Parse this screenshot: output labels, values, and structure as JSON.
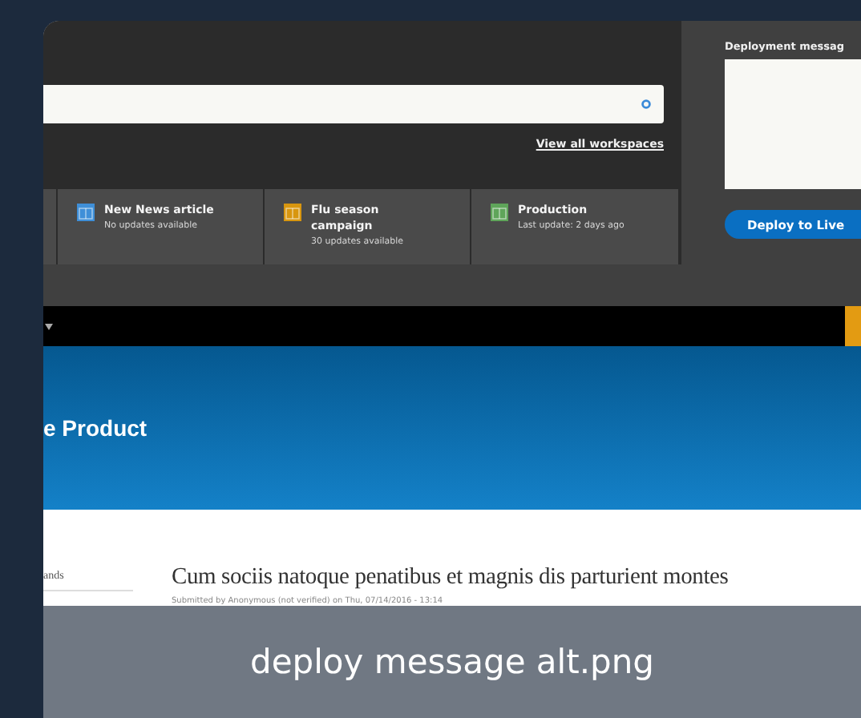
{
  "caption": "deploy message alt.png",
  "workspace_panel": {
    "view_all_link": "View all workspaces",
    "workspaces": [
      {
        "name": "New News article",
        "status": "No updates available",
        "color": "#3f8fd8"
      },
      {
        "name": "Flu season campaign",
        "status": "30 updates available",
        "color": "#d8960f"
      },
      {
        "name": "Production",
        "status": "Last update: 2 days ago",
        "color": "#5fa55a"
      }
    ]
  },
  "deploy_panel": {
    "label": "Deployment messag",
    "button": "Deploy to Live"
  },
  "site": {
    "title": "e Product",
    "sidebar": [
      "ands"
    ],
    "article": {
      "heading": "Cum sociis natoque penatibus et magnis dis parturient montes",
      "meta": "Submitted by Anonymous (not verified) on Thu, 07/14/2016 - 13:14"
    }
  }
}
